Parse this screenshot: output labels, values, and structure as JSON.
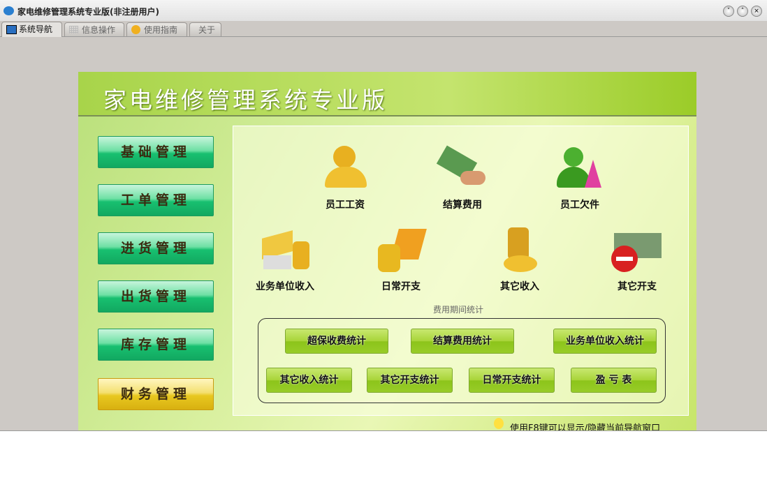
{
  "window": {
    "title": "家电维修管理系统专业版(非注册用户)",
    "controls": [
      "chevron-down",
      "chevron-up",
      "close"
    ]
  },
  "tabs": [
    {
      "label": "系统导航",
      "icon": "monitor-icon",
      "active": true
    },
    {
      "label": "信息操作",
      "icon": "grid-icon"
    },
    {
      "label": "使用指南",
      "icon": "help-icon"
    },
    {
      "label": "关于"
    }
  ],
  "header": {
    "title": "家电维修管理系统专业版"
  },
  "sidebar": {
    "items": [
      {
        "label": "基础管理"
      },
      {
        "label": "工单管理"
      },
      {
        "label": "进货管理"
      },
      {
        "label": "出货管理"
      },
      {
        "label": "库存管理"
      },
      {
        "label": "财务管理",
        "active": true
      }
    ]
  },
  "main": {
    "row1": [
      {
        "label": "员工工资",
        "icon": "money-bag-person-icon"
      },
      {
        "label": "结算费用",
        "icon": "cash-hand-icon"
      },
      {
        "label": "员工欠件",
        "icon": "users-icon"
      }
    ],
    "row2": [
      {
        "label": "业务单位收入",
        "icon": "cards-coins-icon"
      },
      {
        "label": "日常开支",
        "icon": "laptop-coins-icon"
      },
      {
        "label": "其它收入",
        "icon": "coins-icon"
      },
      {
        "label": "其它开支",
        "icon": "money-minus-icon"
      }
    ],
    "section_title": "费用期间统计",
    "stats_buttons": [
      "超保收费统计",
      "结算费用统计",
      "业务单位收入统计",
      "其它收入统计",
      "其它开支统计",
      "日常开支统计",
      "盈 亏 表"
    ]
  },
  "footer": {
    "hint": "使用F8键可以显示/隐藏当前导航窗口"
  },
  "colors": {
    "sidebar_button": "#18c070",
    "sidebar_active": "#e8c820",
    "stats_button": "#98cc28"
  }
}
